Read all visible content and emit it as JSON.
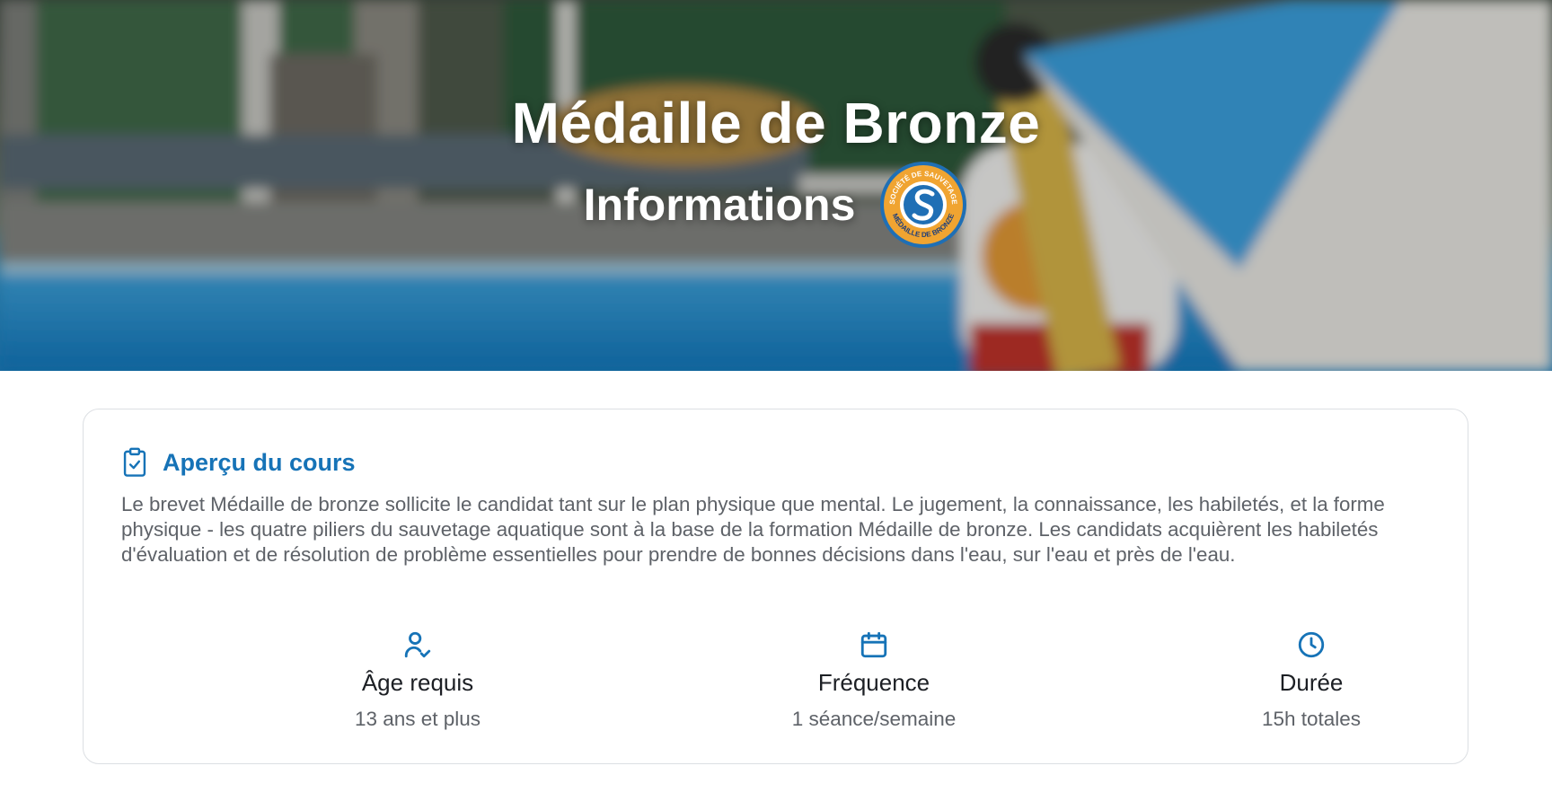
{
  "hero": {
    "title": "Médaille de Bronze",
    "subtitle": "Informations",
    "badge": {
      "top_text": "SOCIÉTÉ DE SAUVETAGE",
      "bottom_text": "MÉDAILLE DE BRONZE",
      "ring_color": "#f0a431",
      "center_color": "#1f6fb5"
    }
  },
  "course": {
    "title": "Aperçu du cours",
    "icon": "clipboard-check-icon",
    "description": "Le brevet Médaille de bronze sollicite le candidat tant sur le plan physique que mental. Le jugement, la connaissance, les habiletés, et la forme physique - les quatre piliers du sauvetage aquatique sont à la base de la formation Médaille de bronze. Les candidats acquièrent les habiletés d'évaluation et de résolution de problème essentielles pour prendre de bonnes décisions dans l'eau, sur l'eau et près de l'eau.",
    "stats": [
      {
        "icon": "user-check-icon",
        "label": "Âge requis",
        "value": "13 ans et plus"
      },
      {
        "icon": "calendar-icon",
        "label": "Fréquence",
        "value": "1 séance/semaine"
      },
      {
        "icon": "clock-icon",
        "label": "Durée",
        "value": "15h totales"
      }
    ]
  },
  "colors": {
    "accent": "#1673b7",
    "text_muted": "#5e6268",
    "border": "#dcdfe3"
  }
}
